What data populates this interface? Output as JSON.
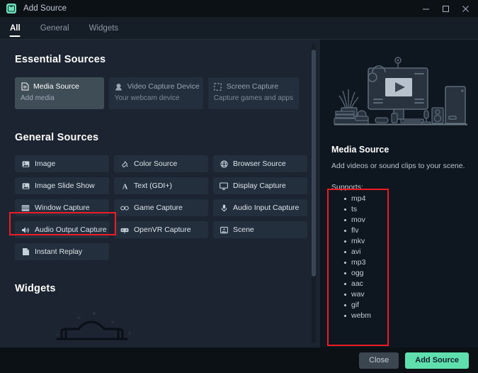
{
  "window": {
    "title": "Add Source",
    "icon": "add-source-icon",
    "controls": {
      "minimize": "minimize-icon",
      "maximize": "maximize-icon",
      "close": "close-icon"
    }
  },
  "tabs": [
    {
      "label": "All",
      "active": true
    },
    {
      "label": "General",
      "active": false
    },
    {
      "label": "Widgets",
      "active": false
    }
  ],
  "sections": {
    "essential": {
      "title": "Essential Sources",
      "cards": [
        {
          "label": "Media Source",
          "sub": "Add media",
          "icon": "media-file-icon",
          "selected": true
        },
        {
          "label": "Video Capture Device",
          "sub": "Your webcam device",
          "icon": "webcam-icon",
          "selected": false
        },
        {
          "label": "Screen Capture",
          "sub": "Capture games and apps",
          "icon": "screen-capture-icon",
          "selected": false
        }
      ]
    },
    "general": {
      "title": "General Sources",
      "items": [
        {
          "label": "Image",
          "icon": "image-icon"
        },
        {
          "label": "Color Source",
          "icon": "color-drop-icon"
        },
        {
          "label": "Browser Source",
          "icon": "globe-icon"
        },
        {
          "label": "Image Slide Show",
          "icon": "image-icon"
        },
        {
          "label": "Text (GDI+)",
          "icon": "text-a-icon"
        },
        {
          "label": "Display Capture",
          "icon": "monitor-icon"
        },
        {
          "label": "Window Capture",
          "icon": "window-icon",
          "highlighted": true
        },
        {
          "label": "Game Capture",
          "icon": "gamepad-icon"
        },
        {
          "label": "Audio Input Capture",
          "icon": "microphone-icon"
        },
        {
          "label": "Audio Output Capture",
          "icon": "speaker-icon"
        },
        {
          "label": "OpenVR Capture",
          "icon": "vr-headset-icon"
        },
        {
          "label": "Scene",
          "icon": "scene-icon"
        },
        {
          "label": "Instant Replay",
          "icon": "replay-file-icon"
        }
      ]
    },
    "widgets": {
      "title": "Widgets"
    }
  },
  "details": {
    "illustration": "desk-setup-with-media-player-illustration",
    "title": "Media Source",
    "description": "Add videos or sound clips to your scene.",
    "supports_label": "Supports:",
    "formats": [
      "mp4",
      "ts",
      "mov",
      "flv",
      "mkv",
      "avi",
      "mp3",
      "ogg",
      "aac",
      "wav",
      "gif",
      "webm"
    ]
  },
  "footer": {
    "close_label": "Close",
    "add_label": "Add Source"
  },
  "colors": {
    "accent": "#5fdfae",
    "annotation": "#ee1b24",
    "panel_left": "#1b2430",
    "panel_right": "#0e1620",
    "card": "#232f3c",
    "card_selected": "#3f4d57"
  }
}
